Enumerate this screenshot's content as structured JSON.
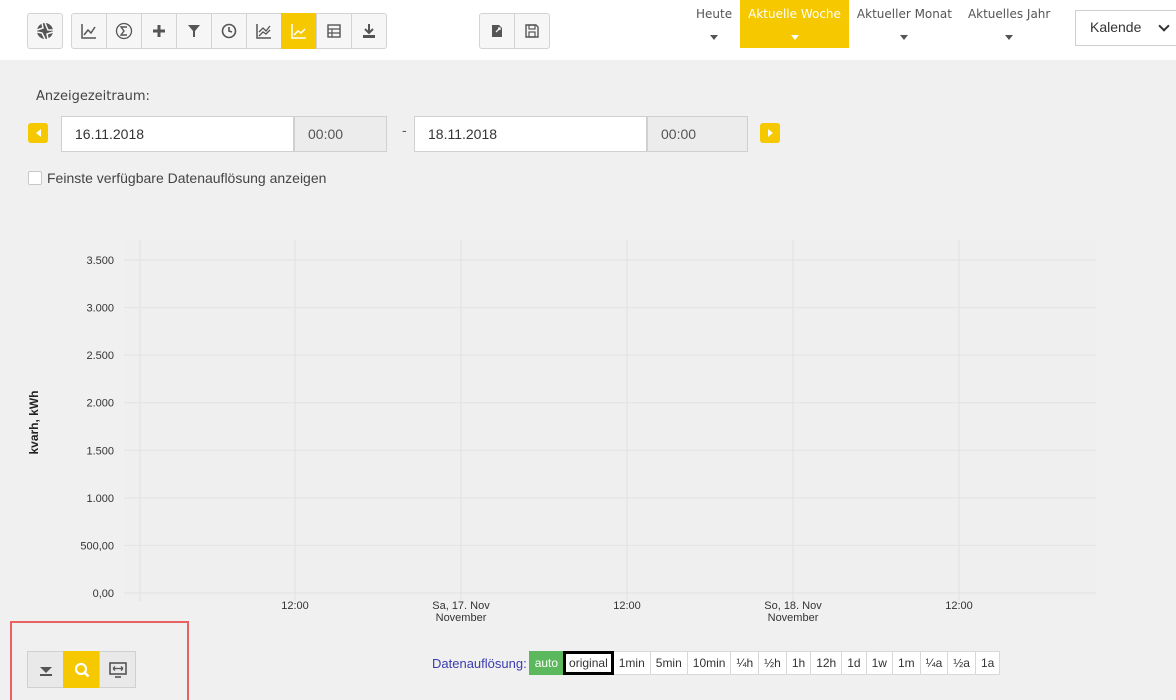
{
  "toolbar": {
    "buttons": [
      {
        "icon": "aperture-icon",
        "active": false
      },
      {
        "icon": "line-chart-icon",
        "active": false
      },
      {
        "icon": "sum-icon",
        "active": false
      },
      {
        "icon": "plus-icon",
        "active": false
      },
      {
        "icon": "filter-icon",
        "active": false
      },
      {
        "icon": "clock-icon",
        "active": false
      },
      {
        "icon": "area-chart-icon",
        "active": false
      },
      {
        "icon": "line-chart-active-icon",
        "active": true
      },
      {
        "icon": "table-icon",
        "active": false
      },
      {
        "icon": "download-icon",
        "active": false
      },
      {
        "icon": "export-icon",
        "active": false
      },
      {
        "icon": "save-icon",
        "active": false
      }
    ]
  },
  "period_tabs": [
    {
      "label": "Heute",
      "active": false
    },
    {
      "label": "Aktuelle Woche",
      "active": true
    },
    {
      "label": "Aktueller Monat",
      "active": false
    },
    {
      "label": "Aktuelles Jahr",
      "active": false
    }
  ],
  "calendar_select": {
    "value": "Kalende"
  },
  "range": {
    "label": "Anzeigezeitraum:",
    "start_date": "16.11.2018",
    "start_time": "00:00",
    "separator": "-",
    "end_date": "18.11.2018",
    "end_time": "00:00"
  },
  "finest_resolution": {
    "label": "Feinste verfügbare Datenauflösung anzeigen",
    "checked": false
  },
  "chart_data": {
    "type": "line",
    "ylabel": "kvarh, kWh",
    "xlabel": "",
    "ylim": [
      0,
      3500
    ],
    "y_ticks": [
      "0,00",
      "500,00",
      "1.000",
      "1.500",
      "2.000",
      "2.500",
      "3.000",
      "3.500"
    ],
    "x_ticks": [
      {
        "label": "12:00",
        "sub": ""
      },
      {
        "label": "Sa, 17. Nov",
        "sub": "November"
      },
      {
        "label": "12:00",
        "sub": ""
      },
      {
        "label": "So, 18. Nov",
        "sub": "November"
      },
      {
        "label": "12:00",
        "sub": ""
      }
    ],
    "series": [],
    "grid": true
  },
  "resolution": {
    "label": "Datenauflösung:",
    "options": [
      {
        "label": "auto",
        "state": "auto"
      },
      {
        "label": "original",
        "state": "selected"
      },
      {
        "label": "1min",
        "state": ""
      },
      {
        "label": "5min",
        "state": ""
      },
      {
        "label": "10min",
        "state": ""
      },
      {
        "label": "¼h",
        "state": ""
      },
      {
        "label": "½h",
        "state": ""
      },
      {
        "label": "1h",
        "state": ""
      },
      {
        "label": "12h",
        "state": ""
      },
      {
        "label": "1d",
        "state": ""
      },
      {
        "label": "1w",
        "state": ""
      },
      {
        "label": "1m",
        "state": ""
      },
      {
        "label": "¼a",
        "state": ""
      },
      {
        "label": "½a",
        "state": ""
      },
      {
        "label": "1a",
        "state": ""
      }
    ]
  },
  "bottom_tools": [
    {
      "icon": "collapse-down-icon",
      "active": false
    },
    {
      "icon": "zoom-icon",
      "active": true
    },
    {
      "icon": "fit-screen-icon",
      "active": false
    }
  ],
  "colors": {
    "accent": "#f5c800",
    "auto_green": "#5cb85c",
    "highlight_red": "#e86262",
    "resolution_label": "#3b3bb0"
  }
}
